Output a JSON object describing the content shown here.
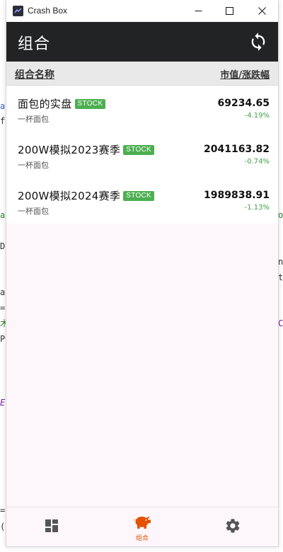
{
  "window": {
    "title": "Crash Box"
  },
  "appbar": {
    "title": "组合"
  },
  "table_header": {
    "name_col": "组合名称",
    "value_col": "市值/涨跌幅"
  },
  "portfolios": [
    {
      "name": "面包的实盘",
      "badge": "STOCK",
      "owner": "一杯面包",
      "value": "69234.65",
      "change": "-4.19%"
    },
    {
      "name": "200W模拟2023赛季",
      "badge": "STOCK",
      "owner": "一杯面包",
      "value": "2041163.82",
      "change": "-0.74%"
    },
    {
      "name": "200W模拟2024赛季",
      "badge": "STOCK",
      "owner": "一杯面包",
      "value": "1989838.91",
      "change": "-1.13%"
    }
  ],
  "bottom_nav": {
    "items": [
      {
        "icon": "dashboard-icon",
        "label": ""
      },
      {
        "icon": "piggy-bank-icon",
        "label": "组合"
      },
      {
        "icon": "gear-icon",
        "label": ""
      }
    ],
    "active_index": 1
  },
  "colors": {
    "appbar_bg": "#222325",
    "badge_bg": "#4caf50",
    "change_color": "#43a047",
    "active_accent": "#e65100",
    "nav_bg": "#fdf7fc"
  }
}
